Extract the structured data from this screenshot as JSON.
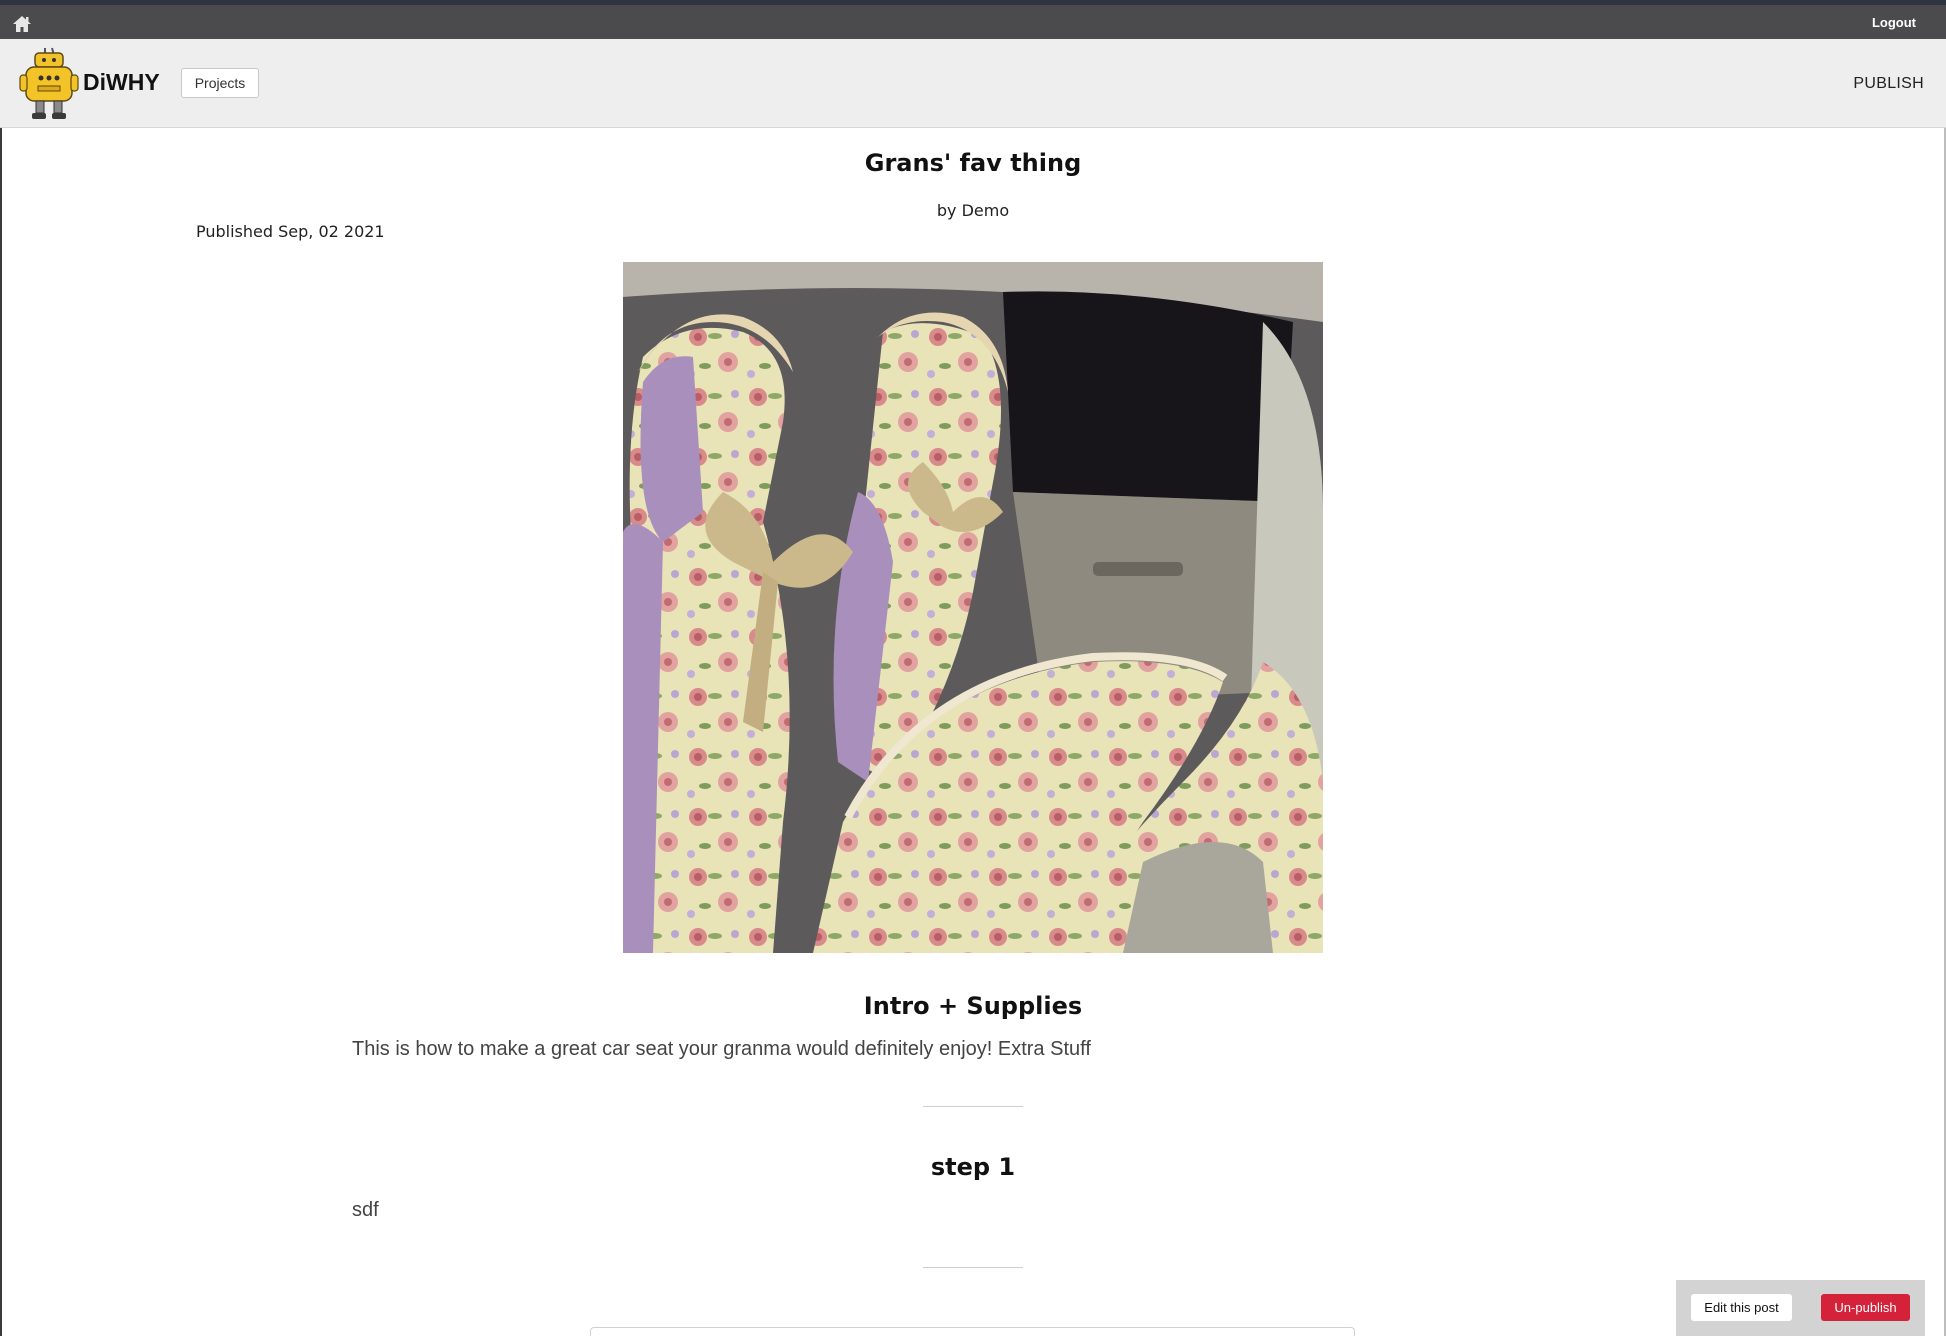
{
  "topbar": {
    "home_icon": "home-icon",
    "logout_label": "Logout"
  },
  "navbar": {
    "brand": "DiWHY",
    "logo_icon": "robot-logo-icon",
    "projects_label": "Projects",
    "publish_label": "PUBLISH"
  },
  "post": {
    "title": "Grans' fav thing",
    "byline": "by Demo",
    "published": "Published Sep, 02 2021",
    "sections": [
      {
        "title": "Intro + Supplies",
        "text": "This is how to make a great car seat your granma would definitely enjoy! Extra Stuff"
      },
      {
        "title": "step 1",
        "text": "sdf"
      }
    ]
  },
  "actions": {
    "edit_label": "Edit this post",
    "unpublish_label": "Un-publish"
  },
  "colors": {
    "topbar": "#4b4b4d",
    "navbar": "#eeeeee",
    "unpublish": "#d32239",
    "panel": "#d3d3d3"
  }
}
